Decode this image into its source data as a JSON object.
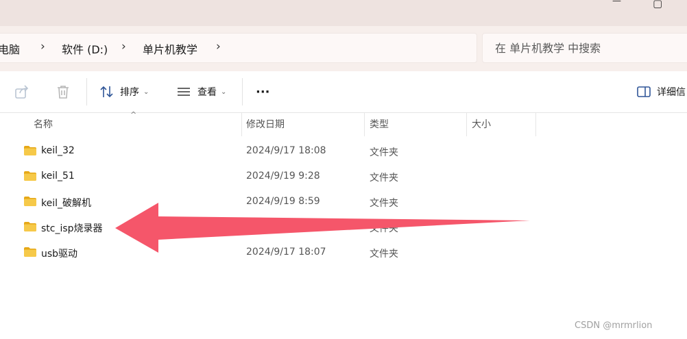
{
  "window": {
    "minimize_glyph": "—",
    "maximize_glyph": "▢"
  },
  "breadcrumb": {
    "items": [
      "电脑",
      "软件 (D:)",
      "单片机教学"
    ],
    "separator": "›"
  },
  "search": {
    "placeholder": "在 单片机教学 中搜索"
  },
  "toolbar": {
    "share_icon": "share-icon",
    "delete_icon": "trash-icon",
    "sort_label": "排序",
    "view_label": "查看",
    "more_label": "···",
    "details_label": "详细信"
  },
  "columns": {
    "name": "名称",
    "modified": "修改日期",
    "type": "类型",
    "size": "大小"
  },
  "files": [
    {
      "name": "keil_32",
      "modified": "2024/9/17 18:08",
      "type": "文件夹",
      "size": ""
    },
    {
      "name": "keil_51",
      "modified": "2024/9/19 9:28",
      "type": "文件夹",
      "size": ""
    },
    {
      "name": "keil_破解机",
      "modified": "2024/9/19 8:59",
      "type": "文件夹",
      "size": ""
    },
    {
      "name": "stc_isp烧录器",
      "modified": "",
      "type": "文件夹",
      "size": ""
    },
    {
      "name": "usb驱动",
      "modified": "2024/9/17 18:07",
      "type": "文件夹",
      "size": ""
    }
  ],
  "annotation": {
    "arrow_color": "#f5566a"
  },
  "watermark": "CSDN @mrmrlion",
  "colors": {
    "folder": "#f4c542",
    "folder_dark": "#e6a817",
    "titlebar_bg": "#eee3e0",
    "address_bg": "#f7efec"
  }
}
